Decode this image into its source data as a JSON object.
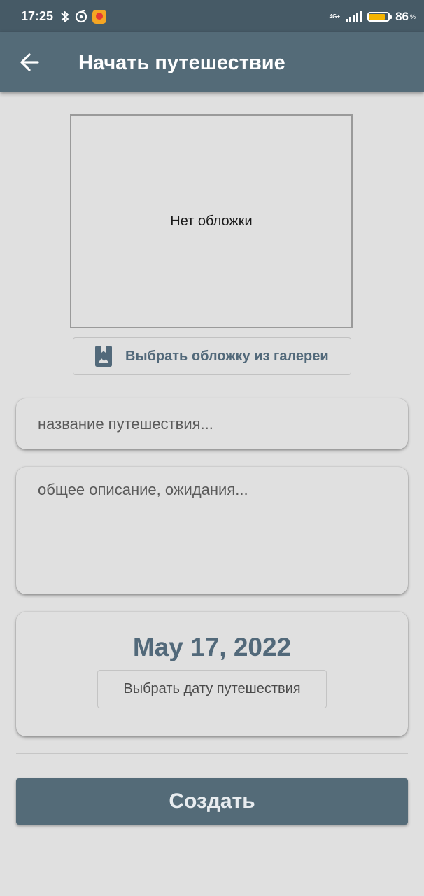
{
  "status_bar": {
    "time": "17:25",
    "network": "4G+",
    "battery_percent": "86",
    "battery_unit": "%",
    "battery_level": 0.86,
    "icons": [
      "bluetooth-icon",
      "data-saver-icon",
      "app-notification-icon",
      "signal-icon",
      "battery-icon"
    ]
  },
  "app_bar": {
    "title": "Начать путешествие",
    "back_icon": "arrow-back-icon"
  },
  "cover": {
    "placeholder": "Нет обложки",
    "gallery_button_label": "Выбрать обложку из галереи",
    "gallery_icon": "gallery-bookmark-icon"
  },
  "form": {
    "title_placeholder": "название путешествия...",
    "title_value": "",
    "description_placeholder": "общее описание, ожидания...",
    "description_value": ""
  },
  "date": {
    "value": "May 17, 2022",
    "button_label": "Выбрать дату путешествия"
  },
  "actions": {
    "create_label": "Создать"
  },
  "colors": {
    "status_bar": "#465a66",
    "primary": "#546b78",
    "accent_text": "#52697a",
    "background": "#e0e0e0"
  }
}
